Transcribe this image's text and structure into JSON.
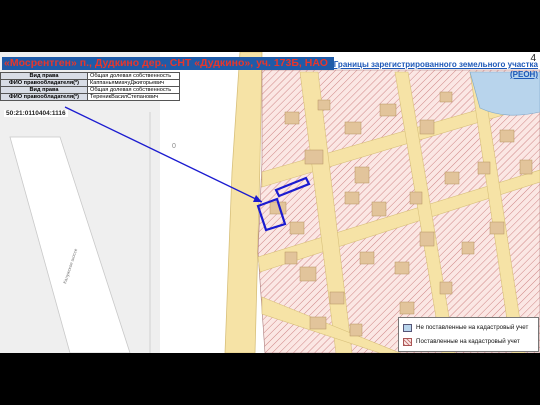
{
  "page_number": "4",
  "title": "«Мосрентген» п., Дудкино дер., СНТ «Дудкино», уч. 173Б, НАО",
  "boundary_label": "Границы зарегистрированного земельного участка (РЕОН)",
  "ownership_table": [
    {
      "key": "Вид права",
      "value": "Общая долевая собственность"
    },
    {
      "key": "ФИО правообладателя(*)",
      "value": "КаппаньямиачуДжигорьевич"
    },
    {
      "key": "Вид права",
      "value": "Общая долевая собственность"
    },
    {
      "key": "ФИО правообладателя(*)",
      "value": "ТереникВасилСтепанович"
    }
  ],
  "cadastral_number": "50:21:0110404:1116",
  "map_labels": {
    "zero_mark": "0",
    "road_label": "Калужское шоссе"
  },
  "legend": {
    "not_registered": "Не поставленные на кадастровый учет",
    "registered": "Поставленные на кадастровый учет"
  },
  "colors": {
    "title_bg": "#1f5ba8",
    "title_text": "#e8362b",
    "parcel_fill": "#fbe7e4",
    "parcel_hatch": "#c97a7a",
    "building": "#e2c49b",
    "road": "#f6e3a6",
    "water": "#b8d4ec",
    "highlight": "#1b1bd0"
  }
}
